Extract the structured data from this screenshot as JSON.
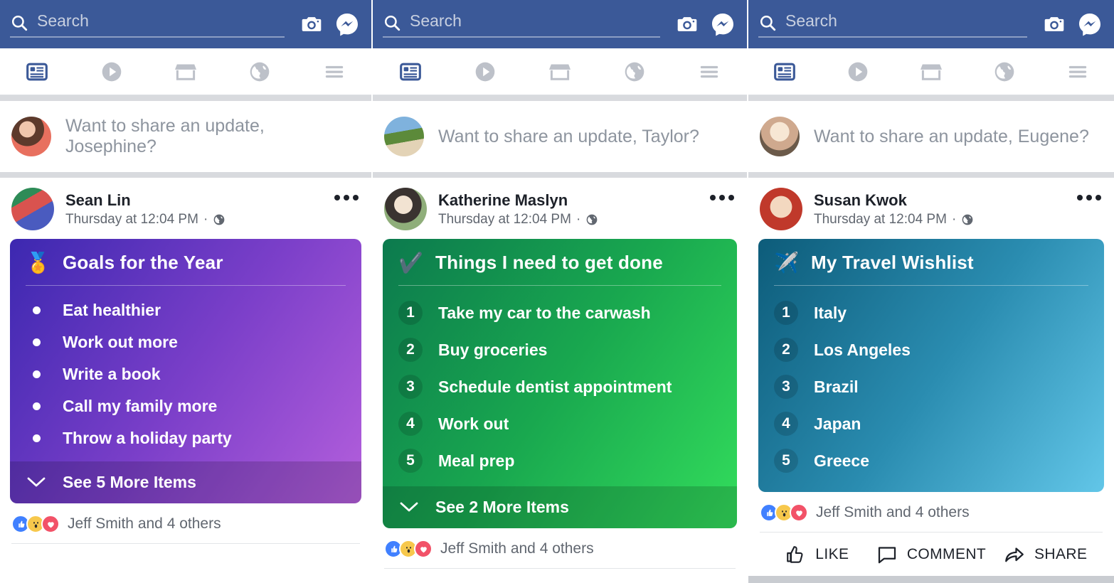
{
  "header": {
    "search_placeholder": "Search",
    "search_value": "",
    "camera_icon": "camera-icon",
    "messenger_icon": "messenger-icon",
    "brand_color": "#3b5998"
  },
  "nav": {
    "items": [
      {
        "name": "news-feed",
        "icon": "news-feed-icon",
        "active": true
      },
      {
        "name": "watch",
        "icon": "play-circle-icon",
        "active": false
      },
      {
        "name": "marketplace",
        "icon": "storefront-icon",
        "active": false
      },
      {
        "name": "notifications",
        "icon": "globe-icon",
        "active": false
      },
      {
        "name": "menu",
        "icon": "hamburger-menu-icon",
        "active": false
      }
    ],
    "active_color": "#3b5998",
    "inactive_color": "#bdc1c9"
  },
  "columns": [
    {
      "composer": {
        "prompt": "Want to share an update, Josephine?"
      },
      "post": {
        "author": "Sean Lin",
        "timestamp": "Thursday at 12:04 PM",
        "privacy_icon": "globe-icon",
        "menu_icon": "ellipsis-icon"
      },
      "card": {
        "emoji": "🏅",
        "emoji_name": "medal-emoji",
        "title": "Goals for the Year",
        "style": "bullet",
        "gradient_from": "#3c28b0",
        "gradient_to": "#b45fdc",
        "items": [
          "Eat healthier",
          "Work out more",
          "Write a book",
          "Call my family more",
          "Throw a holiday party"
        ],
        "more_label": "See 5 More Items"
      },
      "reactions": {
        "text": "Jeff Smith and 4 others",
        "pills": [
          "like",
          "wow",
          "love"
        ]
      },
      "actions_visible": false
    },
    {
      "composer": {
        "prompt": "Want to share an update, Taylor?"
      },
      "post": {
        "author": "Katherine Maslyn",
        "timestamp": "Thursday at 12:04 PM",
        "privacy_icon": "globe-icon",
        "menu_icon": "ellipsis-icon"
      },
      "card": {
        "emoji": "✔️",
        "emoji_name": "check-mark-emoji",
        "title": "Things I need to get done",
        "style": "numbered",
        "gradient_from": "#0c7a4e",
        "gradient_to": "#33dd5c",
        "items": [
          "Take my car to the carwash",
          "Buy groceries",
          "Schedule dentist appointment",
          "Work out",
          "Meal prep"
        ],
        "more_label": "See 2 More Items"
      },
      "reactions": {
        "text": "Jeff Smith and 4 others",
        "pills": [
          "like",
          "wow",
          "love"
        ]
      },
      "actions_visible": false
    },
    {
      "composer": {
        "prompt": "Want to share an update, Eugene?"
      },
      "post": {
        "author": "Susan Kwok",
        "timestamp": "Thursday at 12:04 PM",
        "privacy_icon": "globe-icon",
        "menu_icon": "ellipsis-icon"
      },
      "card": {
        "emoji": "✈️",
        "emoji_name": "airplane-emoji",
        "title": "My Travel Wishlist",
        "style": "numbered",
        "gradient_from": "#0d5c7a",
        "gradient_to": "#62c6e8",
        "items": [
          "Italy",
          "Los Angeles",
          "Brazil",
          "Japan",
          "Greece"
        ],
        "more_label": ""
      },
      "reactions": {
        "text": "Jeff Smith and 4 others",
        "pills": [
          "like",
          "wow",
          "love"
        ]
      },
      "actions_visible": true,
      "actions": [
        {
          "label": "LIKE",
          "icon": "thumbs-up-icon"
        },
        {
          "label": "COMMENT",
          "icon": "comment-bubble-icon"
        },
        {
          "label": "SHARE",
          "icon": "share-arrow-icon"
        }
      ]
    }
  ]
}
